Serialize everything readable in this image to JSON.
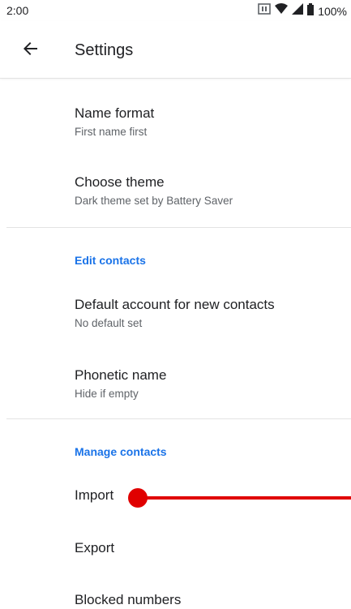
{
  "status_bar": {
    "time": "2:00",
    "battery_percent": "100%",
    "icons": [
      "nfc-icon",
      "wifi-icon",
      "signal-icon",
      "battery-icon"
    ]
  },
  "app_bar": {
    "title": "Settings",
    "back_icon": "arrow-back-icon"
  },
  "display_section": {
    "items": [
      {
        "title": "Name format",
        "subtitle": "First name first"
      },
      {
        "title": "Choose theme",
        "subtitle": "Dark theme set by Battery Saver"
      }
    ]
  },
  "edit_section": {
    "header": "Edit contacts",
    "items": [
      {
        "title": "Default account for new contacts",
        "subtitle": "No default set"
      },
      {
        "title": "Phonetic name",
        "subtitle": "Hide if empty"
      }
    ]
  },
  "manage_section": {
    "header": "Manage contacts",
    "items": [
      {
        "title": "Import"
      },
      {
        "title": "Export"
      },
      {
        "title": "Blocked numbers"
      }
    ]
  },
  "colors": {
    "accent": "#1a73e8",
    "touch_marker": "#e00000",
    "text_primary": "#202124",
    "text_secondary": "#5f6368"
  }
}
